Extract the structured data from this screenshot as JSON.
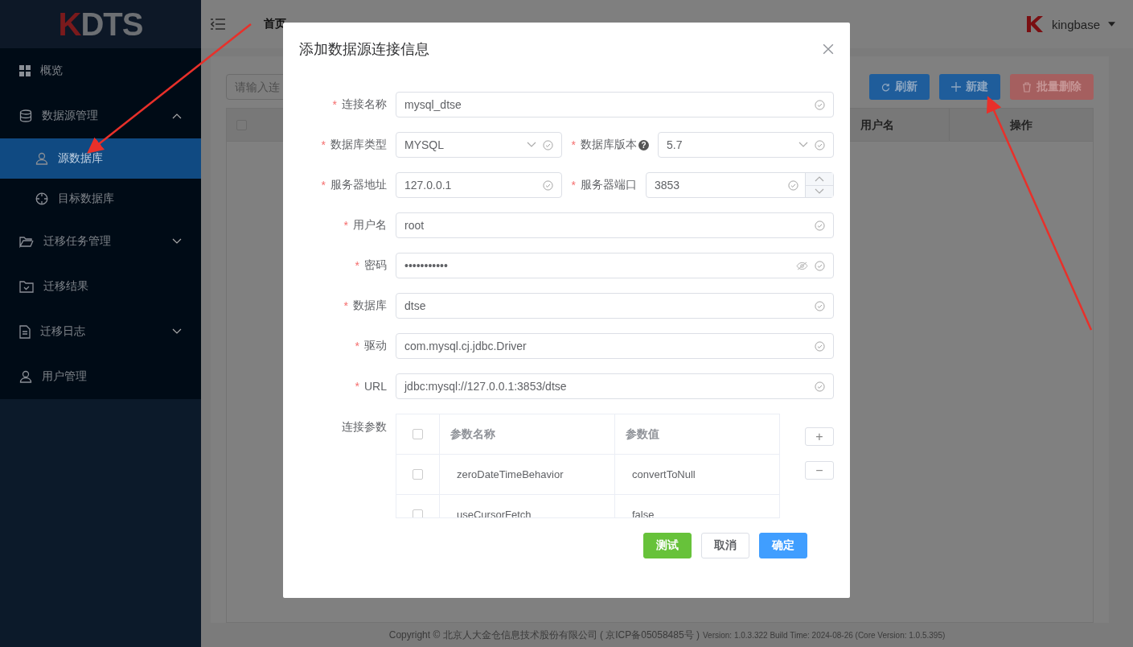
{
  "logo": {
    "mark": "K",
    "text": "DTS"
  },
  "sidebar": {
    "items": [
      {
        "label": "概览",
        "selected": false
      },
      {
        "label": "数据源管理",
        "expanded": true,
        "selected": false,
        "children": [
          {
            "label": "源数据库",
            "selected": true
          },
          {
            "label": "目标数据库",
            "selected": false
          }
        ]
      },
      {
        "label": "迁移任务管理",
        "expanded": false,
        "selected": false
      },
      {
        "label": "迁移结果",
        "selected": false
      },
      {
        "label": "迁移日志",
        "expanded": false,
        "selected": false
      },
      {
        "label": "用户管理",
        "selected": false
      }
    ]
  },
  "header": {
    "breadcrumb": [
      "首页"
    ],
    "user": "kingbase"
  },
  "toolbar": {
    "search": {
      "placeholder": "请输入连"
    },
    "buttons": [
      {
        "label": "刷新",
        "kind": "refresh",
        "disabled": false
      },
      {
        "label": "新建",
        "kind": "add",
        "disabled": false
      },
      {
        "label": "批量删除",
        "kind": "delete",
        "disabled": true
      }
    ]
  },
  "table": {
    "header_checked": false,
    "columns": [
      "用户名",
      "操作"
    ]
  },
  "dialog": {
    "title": "添加数据源连接信息",
    "rows": [
      [
        {
          "required_mark": "*",
          "label": "连接名称",
          "value": "mysql_dtse",
          "kind": "text"
        }
      ],
      [
        {
          "required_mark": "*",
          "label": "数据库类型",
          "value": "MYSQL",
          "kind": "select"
        },
        {
          "required_mark": "*",
          "label": "数据库版本",
          "value": "5.7",
          "kind": "select",
          "help": "?"
        }
      ],
      [
        {
          "required_mark": "*",
          "label": "服务器地址",
          "value": "127.0.0.1",
          "kind": "text"
        },
        {
          "required_mark": "*",
          "label": "服务器端口",
          "value": "3853",
          "kind": "number"
        }
      ],
      [
        {
          "required_mark": "*",
          "label": "用户名",
          "value": "root",
          "kind": "text"
        }
      ],
      [
        {
          "required_mark": "*",
          "label": "密码",
          "value": "•••••••••••",
          "kind": "password"
        }
      ],
      [
        {
          "required_mark": "*",
          "label": "数据库",
          "value": "dtse",
          "kind": "text"
        }
      ],
      [
        {
          "required_mark": "*",
          "label": "驱动",
          "value": "com.mysql.cj.jdbc.Driver",
          "kind": "text"
        }
      ],
      [
        {
          "required_mark": "*",
          "label": "URL",
          "value": "jdbc:mysql://127.0.0.1:3853/dtse",
          "kind": "text"
        }
      ]
    ],
    "params": {
      "label": "连接参数",
      "header_checked": false,
      "columns": [
        "参数名称",
        "参数值"
      ],
      "rows": [
        {
          "checked": false,
          "name": "zeroDateTimeBehavior",
          "value": "convertToNull"
        },
        {
          "checked": false,
          "name": "useCursorFetch",
          "value": "false"
        }
      ],
      "add": "+",
      "remove": "−"
    },
    "buttons": [
      {
        "label": "测试",
        "kind": "success"
      },
      {
        "label": "取消",
        "kind": "default"
      },
      {
        "label": "确定",
        "kind": "primary"
      }
    ]
  },
  "footer": {
    "copyright": "Copyright © 北京人大金仓信息技术股份有限公司 ( 京ICP备05058485号 )",
    "version": "Version: 1.0.3.322 Build Time: 2024-08-26 (Core Version: 1.0.5.395)"
  }
}
